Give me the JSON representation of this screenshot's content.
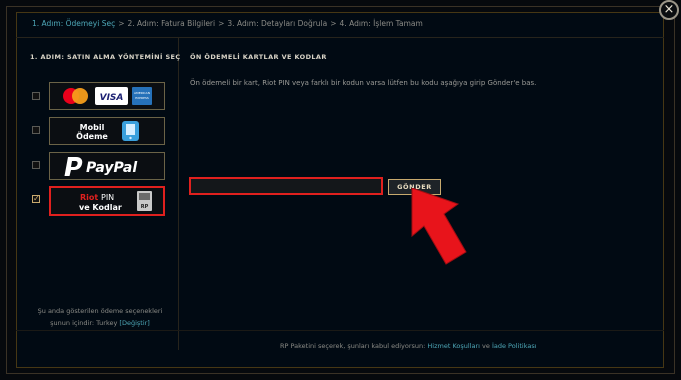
{
  "breadcrumb": {
    "step1": "1. Adım: Ödemeyi Seç",
    "step2": "2. Adım: Fatura Bilgileri",
    "step3": "3. Adım: Detayları Doğrula",
    "step4": "4. Adım: İşlem Tamam",
    "separator": ">"
  },
  "close_label": "×",
  "left_panel": {
    "title": "1. ADIM: SATIN ALMA YÖNTEMİNİ SEÇ",
    "methods": [
      {
        "name": "card",
        "checked": false
      },
      {
        "name": "mobile",
        "label_line1": "Mobil",
        "label_line2": "Ödeme",
        "checked": false
      },
      {
        "name": "paypal",
        "label": "PayPal",
        "checked": false
      },
      {
        "name": "riot-pin",
        "label_red": "Riot",
        "label_pin": "PIN",
        "label_line2": "ve Kodlar",
        "badge": "RP",
        "checked": true
      }
    ],
    "card_brands": {
      "visa": "VISA",
      "amex": "AMERICAN EXPRESS"
    },
    "check_mark": "✓",
    "footer_line1": "Şu anda gösterilen ödeme seçenekleri",
    "footer_line2": "şunun içindir:",
    "footer_country": "Turkey",
    "footer_change": "[Değiştir]"
  },
  "right_panel": {
    "title": "ÖN ÖDEMELİ KARTLAR VE KODLAR",
    "description": "Ön ödemeli bir kart, Riot PIN veya farklı bir kodun varsa lütfen bu kodu aşağıya girip Gönder'e bas.",
    "code_value": "",
    "send_label": "GÖNDER"
  },
  "footer": {
    "text": "RP Paketini seçerek, şunları kabul ediyorsun:",
    "terms": "Hizmet Koşulları",
    "and": "ve",
    "refund": "İade Politikası"
  },
  "colors": {
    "accent_gold": "#c8aa6e",
    "link": "#4ea8b8",
    "highlight_red": "#e0201e"
  }
}
